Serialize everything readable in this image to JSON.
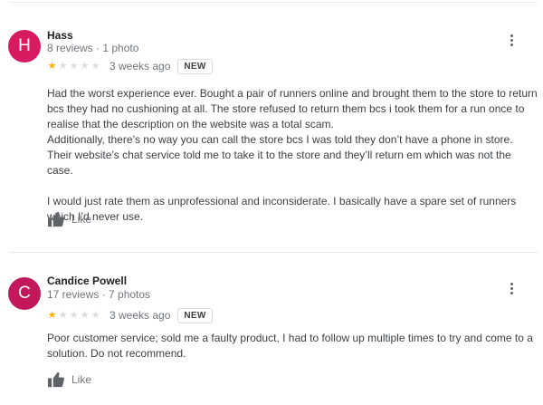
{
  "reviews": [
    {
      "avatar_letter": "H",
      "avatar_color": "#d81b60",
      "name": "Hass",
      "meta": "8 reviews · 1 photo",
      "rating": 1,
      "rating_max": 5,
      "ago": "3 weeks ago",
      "badge": "NEW",
      "paragraphs": [
        "Had the worst experience ever. Bought a pair of runners online and brought them to the store to return bcs they had no cushioning at all. The store refused to return them bcs i took them for a run once to realise that the description on the website was a total scam.",
        "Additionally, there’s no way you can call the store bcs I was told they don’t have a phone in store. Their website’s chat service told me to take it to the store and they’ll return em which was not the case.",
        "I would just rate them as unprofessional and inconsiderate. I basically have a spare set of runners which I’d never use."
      ],
      "like_label": "Like",
      "icons": {
        "more": "more-vert-icon",
        "like": "thumbs-up-icon"
      }
    },
    {
      "avatar_letter": "C",
      "avatar_color": "#c2185b",
      "name": "Candice Powell",
      "meta": "17 reviews · 7 photos",
      "rating": 1,
      "rating_max": 5,
      "ago": "3 weeks ago",
      "badge": "NEW",
      "paragraphs": [
        "Poor customer service; sold me a faulty product, I had to follow up multiple times to try and come to a solution. Do not recommend."
      ],
      "like_label": "Like",
      "icons": {
        "more": "more-vert-icon",
        "like": "thumbs-up-icon"
      }
    }
  ]
}
